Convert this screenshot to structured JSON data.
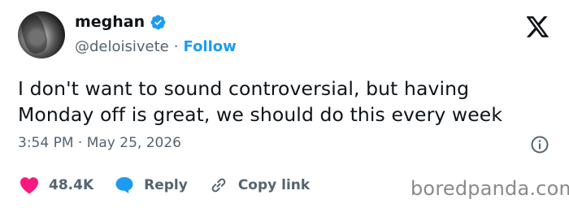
{
  "user": {
    "display_name": "meghan",
    "handle": "@deloisivete",
    "separator": "·",
    "follow_label": "Follow"
  },
  "tweet": {
    "line1": "I don't want to sound controversial, but having",
    "line2": "Monday off is great, we should do this every week",
    "timestamp": "3:54 PM · May 25, 2026"
  },
  "actions": {
    "likes_count": "48.4K",
    "reply_label": "Reply",
    "copy_link_label": "Copy link"
  },
  "watermark": "boredpanda.com",
  "icons": [
    "verified-badge-icon",
    "x-logo-icon",
    "info-icon",
    "heart-icon",
    "reply-bubble-icon",
    "link-icon"
  ],
  "colors": {
    "text": "#0f1419",
    "secondary": "#536471",
    "accent": "#1d9bf0",
    "like": "#f91880"
  }
}
